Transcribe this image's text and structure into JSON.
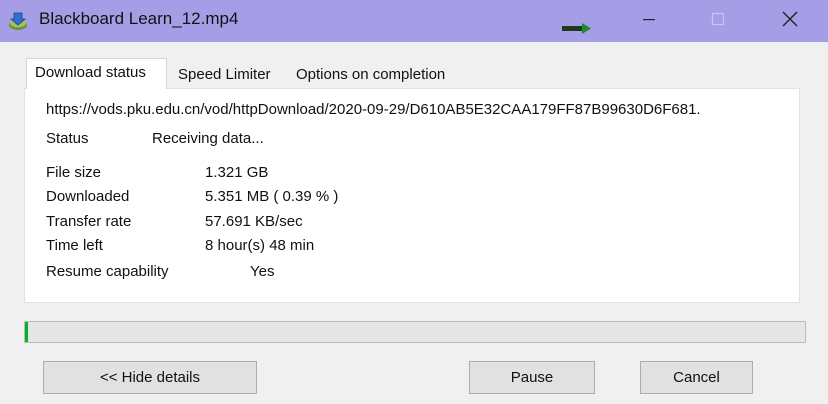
{
  "window": {
    "title": "Blackboard Learn_12.mp4",
    "accent": "#a59ee6"
  },
  "tabs": [
    {
      "label": "Download status",
      "active": true
    },
    {
      "label": "Speed Limiter",
      "active": false
    },
    {
      "label": "Options on completion",
      "active": false
    }
  ],
  "status": {
    "url": "https://vods.pku.edu.cn/vod/httpDownload/2020-09-29/D610AB5E32CAA179FF87B99630D6F681.",
    "status_label": "Status",
    "status_value": "Receiving data...",
    "rows": [
      {
        "label": "File size",
        "value": "1.321  GB"
      },
      {
        "label": "Downloaded",
        "value": "5.351  MB  ( 0.39 % )"
      },
      {
        "label": "Transfer rate",
        "value": "57.691  KB/sec"
      },
      {
        "label": "Time left",
        "value": "8 hour(s) 48 min"
      },
      {
        "label": "Resume capability",
        "value": "Yes"
      }
    ]
  },
  "progress": {
    "percent": 0.39,
    "fill_color": "#06b025"
  },
  "buttons": {
    "hide_details": "<< Hide details",
    "pause": "Pause",
    "cancel": "Cancel"
  },
  "icons": {
    "app": "idm-download-icon",
    "arrow": "progress-arrow-icon",
    "minimize": "minimize-icon",
    "maximize": "maximize-icon",
    "close": "close-icon"
  }
}
